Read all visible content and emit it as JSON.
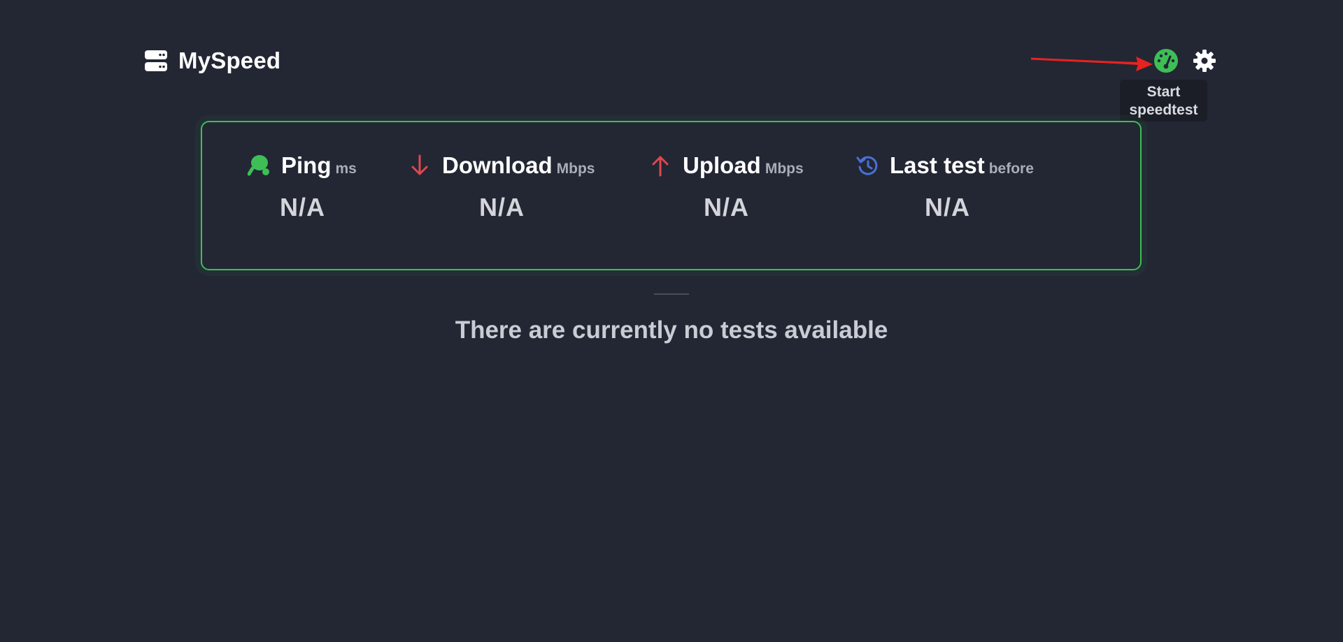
{
  "header": {
    "app_name": "MySpeed",
    "logo_icon": "server-icon",
    "start_button_icon": "speedometer-icon",
    "settings_button_icon": "gear-icon",
    "tooltip_line1": "Start",
    "tooltip_line2": "speedtest"
  },
  "stats": [
    {
      "title": "Ping",
      "unit": "ms",
      "value": "N/A",
      "icon": "ping-pong-icon",
      "icon_color": "#3dbf55"
    },
    {
      "title": "Download",
      "unit": "Mbps",
      "value": "N/A",
      "icon": "arrow-down-icon",
      "icon_color": "#e0474e"
    },
    {
      "title": "Upload",
      "unit": "Mbps",
      "value": "N/A",
      "icon": "arrow-up-icon",
      "icon_color": "#e0474e"
    },
    {
      "title": "Last test",
      "unit": "before",
      "value": "N/A",
      "icon": "history-icon",
      "icon_color": "#4a6fd8"
    }
  ],
  "empty_state": {
    "message": "There are currently no tests available"
  },
  "colors": {
    "background": "#232734",
    "accent_green": "#3dbf55",
    "annotation_red": "#e8231f"
  }
}
